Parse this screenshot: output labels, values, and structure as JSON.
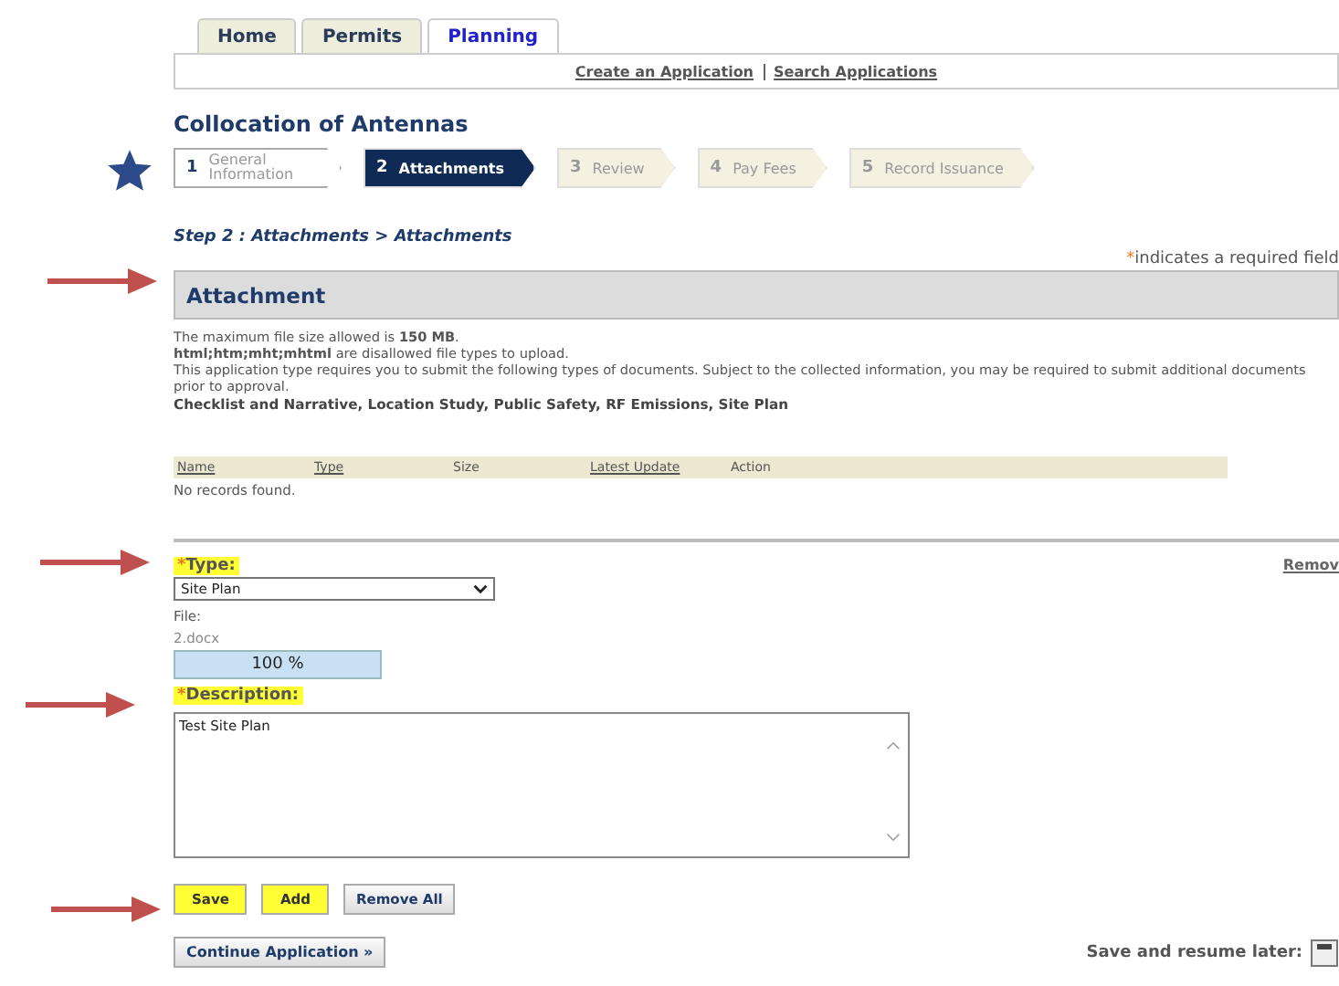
{
  "tabs": [
    {
      "label": "Home",
      "selected": false
    },
    {
      "label": "Permits",
      "selected": false
    },
    {
      "label": "Planning",
      "selected": true
    }
  ],
  "subnav": [
    "Create an Application",
    "Search Applications"
  ],
  "title": "Collocation of Antennas",
  "steps": [
    {
      "number": "1",
      "label": "General Information",
      "selected": false,
      "disabled": false
    },
    {
      "number": "2",
      "label": "Attachments",
      "selected": true,
      "disabled": false
    },
    {
      "number": "3",
      "label": "Review",
      "selected": false,
      "disabled": true
    },
    {
      "number": "4",
      "label": "Pay Fees",
      "selected": false,
      "disabled": true
    },
    {
      "number": "5",
      "label": "Record Issuance",
      "selected": false,
      "disabled": true
    }
  ],
  "step_heading": "Step 2 : Attachments > Attachments",
  "required_note": {
    "mark": "*",
    "text": "indicates a required field"
  },
  "section_title": "Attachment",
  "info": [
    "The maximum file size allowed is **150 MB**.",
    "**html;htm;mht;mhtml** are disallowed file types to upload.",
    "This application type requires you to submit the following types of documents. Subject to the collected information, you may be required to submit additional documents prior to approval."
  ],
  "required_docs": "Checklist and Narrative, Location Study, Public Safety, RF Emissions, Site Plan",
  "table": {
    "columns": [
      {
        "label": "Name",
        "sortable": true
      },
      {
        "label": "Type",
        "sortable": true
      },
      {
        "label": "Size",
        "sortable": false
      },
      {
        "label": "Latest Update",
        "sortable": true
      },
      {
        "label": "Action",
        "sortable": false
      }
    ],
    "empty": "No records found."
  },
  "remove_link": "Remov",
  "type_field": {
    "label": "Type:",
    "required": true,
    "highlighted": true,
    "value": "Site Plan"
  },
  "file": {
    "label": "File:",
    "name": "2.docx",
    "level": 1.0,
    "reading": "100 %"
  },
  "description_field": {
    "label": "Description:",
    "required": true,
    "highlighted": true,
    "value": "Test Site Plan"
  },
  "buttons": [
    {
      "label": "Save",
      "highlighted": true
    },
    {
      "label": "Add",
      "highlighted": true
    },
    {
      "label": "Remove All",
      "highlighted": false
    }
  ],
  "continue_button": "Continue Application »",
  "save_later": "Save and resume later:"
}
